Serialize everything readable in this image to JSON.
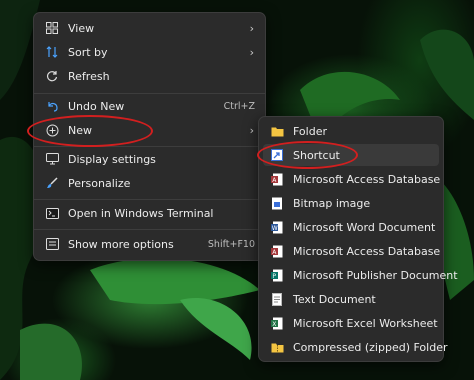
{
  "main_menu": {
    "items": [
      {
        "label": "View",
        "icon": "grid-view-icon"
      },
      {
        "label": "Sort by",
        "icon": "sort-icon"
      },
      {
        "label": "Refresh",
        "icon": "refresh-icon"
      },
      {
        "label": "Undo New",
        "icon": "undo-icon",
        "shortcut": "Ctrl+Z"
      },
      {
        "label": "New",
        "icon": "new-plus-icon"
      },
      {
        "label": "Display settings",
        "icon": "display-settings-icon"
      },
      {
        "label": "Personalize",
        "icon": "personalize-brush-icon"
      },
      {
        "label": "Open in Windows Terminal",
        "icon": "terminal-icon"
      },
      {
        "label": "Show more options",
        "icon": "show-more-options-icon",
        "shortcut": "Shift+F10"
      }
    ]
  },
  "new_submenu": {
    "items": [
      {
        "label": "Folder",
        "icon": "folder-icon"
      },
      {
        "label": "Shortcut",
        "icon": "shortcut-icon"
      },
      {
        "label": "Microsoft Access Database",
        "icon": "access-icon"
      },
      {
        "label": "Bitmap image",
        "icon": "bitmap-icon"
      },
      {
        "label": "Microsoft Word Document",
        "icon": "word-icon"
      },
      {
        "label": "Microsoft Access Database",
        "icon": "access-icon"
      },
      {
        "label": "Microsoft Publisher Document",
        "icon": "publisher-icon"
      },
      {
        "label": "Text Document",
        "icon": "text-document-icon"
      },
      {
        "label": "Microsoft Excel Worksheet",
        "icon": "excel-icon"
      },
      {
        "label": "Compressed (zipped) Folder",
        "icon": "zip-folder-icon"
      }
    ]
  },
  "colors": {
    "menu_bg": "#2b2b2b",
    "highlight_ring": "#d21f1f",
    "accent_green": "#2e7d32"
  }
}
